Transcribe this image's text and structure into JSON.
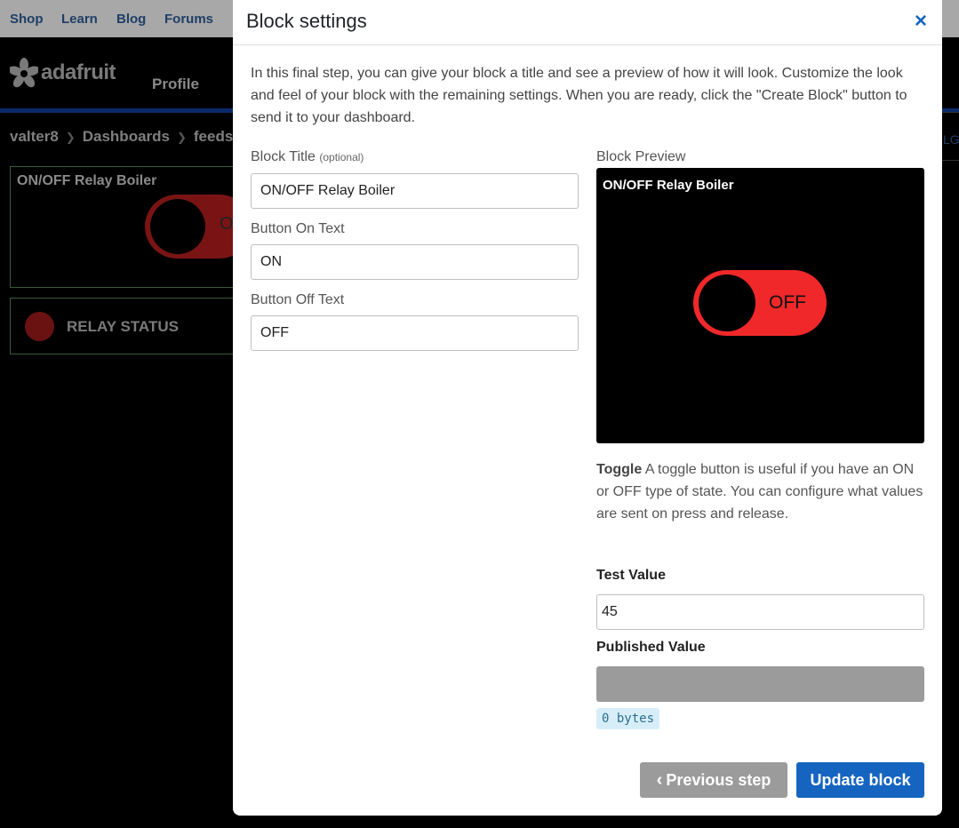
{
  "topnav": {
    "items": [
      "Shop",
      "Learn",
      "Blog",
      "Forums"
    ]
  },
  "header": {
    "logo_text": "adafruit",
    "profile": "Profile"
  },
  "breadcrumb": [
    "valter8",
    "Dashboards",
    "feeds"
  ],
  "background": {
    "block1_title": "ON/OFF Relay Boiler",
    "block1_toggle_text": "O",
    "block2_title": "RELAY STATUS",
    "right_fragment": "LG"
  },
  "modal": {
    "title": "Block settings",
    "close_glyph": "×",
    "intro": "In this final step, you can give your block a title and see a preview of how it will look. Customize the look and feel of your block with the remaining settings. When you are ready, click the \"Create Block\" button to send it to your dashboard.",
    "fields": {
      "block_title_label": "Block Title",
      "block_title_optional": "(optional)",
      "block_title_value": "ON/OFF Relay Boiler",
      "on_text_label": "Button On Text",
      "on_text_value": "ON",
      "off_text_label": "Button Off Text",
      "off_text_value": "OFF"
    },
    "preview": {
      "label": "Block Preview",
      "title": "ON/OFF Relay Boiler",
      "toggle_label": "OFF",
      "toggle_color": "#f1282a"
    },
    "description": {
      "name": "Toggle",
      "text": " A toggle button is useful if you have an ON or OFF type of state. You can configure what values are sent on press and release."
    },
    "test_value_label": "Test Value",
    "test_value": "45",
    "published_value_label": "Published Value",
    "published_bytes": "0 bytes",
    "buttons": {
      "previous": "Previous step",
      "update": "Update block"
    }
  }
}
